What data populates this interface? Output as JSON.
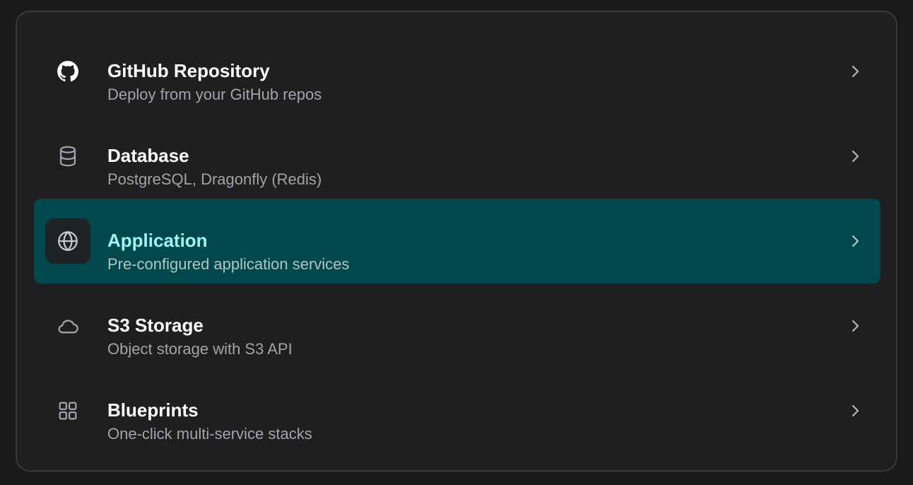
{
  "options": [
    {
      "title": "GitHub Repository",
      "subtitle": "Deploy from your GitHub repos",
      "icon": "github-icon"
    },
    {
      "title": "Database",
      "subtitle": "PostgreSQL, Dragonfly (Redis)",
      "icon": "database-icon"
    },
    {
      "title": "Application",
      "subtitle": "Pre-configured application services",
      "icon": "globe-icon",
      "selected": true
    },
    {
      "title": "S3 Storage",
      "subtitle": "Object storage with S3 API",
      "icon": "cloud-icon"
    },
    {
      "title": "Blueprints",
      "subtitle": "One-click multi-service stacks",
      "icon": "grid-icon"
    }
  ],
  "colors": {
    "page_bg": "#1a1a1b",
    "panel_bg": "#1f1f21",
    "selected_bg": "#00484b",
    "selected_title": "#9ef6f4"
  }
}
